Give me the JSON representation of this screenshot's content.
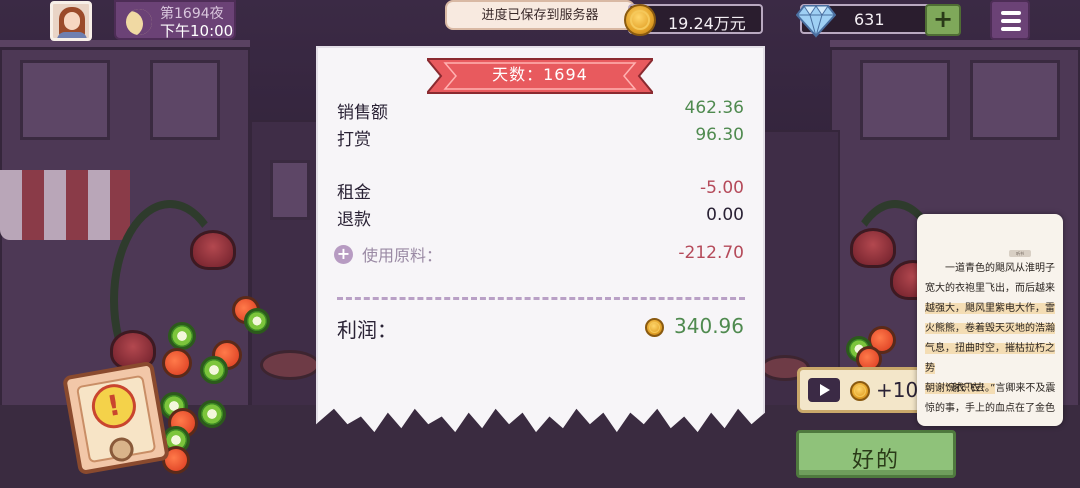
{
  "hud": {
    "night_label": "第1694夜",
    "time_label": "下午10:00",
    "toast": "进度已保存到服务器",
    "money": "19.24万元",
    "gems": "631",
    "plus_label": "+"
  },
  "receipt": {
    "day_title": "天数：1694",
    "rows": [
      {
        "label": "销售额",
        "value": "462.36"
      },
      {
        "label": "打赏",
        "value": "96.30"
      },
      {
        "label": "租金",
        "value": "-5.00"
      },
      {
        "label": "退款",
        "value": "0.00"
      }
    ],
    "ingredients_label": "使用原料：",
    "ingredients_value": "-212.70",
    "profit_label": "利润：",
    "profit_value": "340.96"
  },
  "alert": {
    "symbol": "!"
  },
  "reward": {
    "value": "+10"
  },
  "ok_button": {
    "label": "好的"
  },
  "reader": {
    "tag": "听书",
    "paragraph1_lines": [
      "一道青色的飓风从淮明子",
      "宽大的衣袍里飞出，而后越来",
      "越强大，飓风里紫电大作，雷",
      "火熊熊，卷着毁天灭地的浩瀚",
      "气息，扭曲时空，摧枯拉朽之势",
      "朝谢识衣飞去。"
    ],
    "paragraph2_lines": [
      "“谢识衣！”言卿来不及震",
      "惊的事，手上的血点在了金色"
    ]
  },
  "colors": {
    "positive": "#4f8a4f",
    "negative": "#b54a5a",
    "ribbon": "#e85a5e",
    "ok_button": "#8fc27a"
  }
}
